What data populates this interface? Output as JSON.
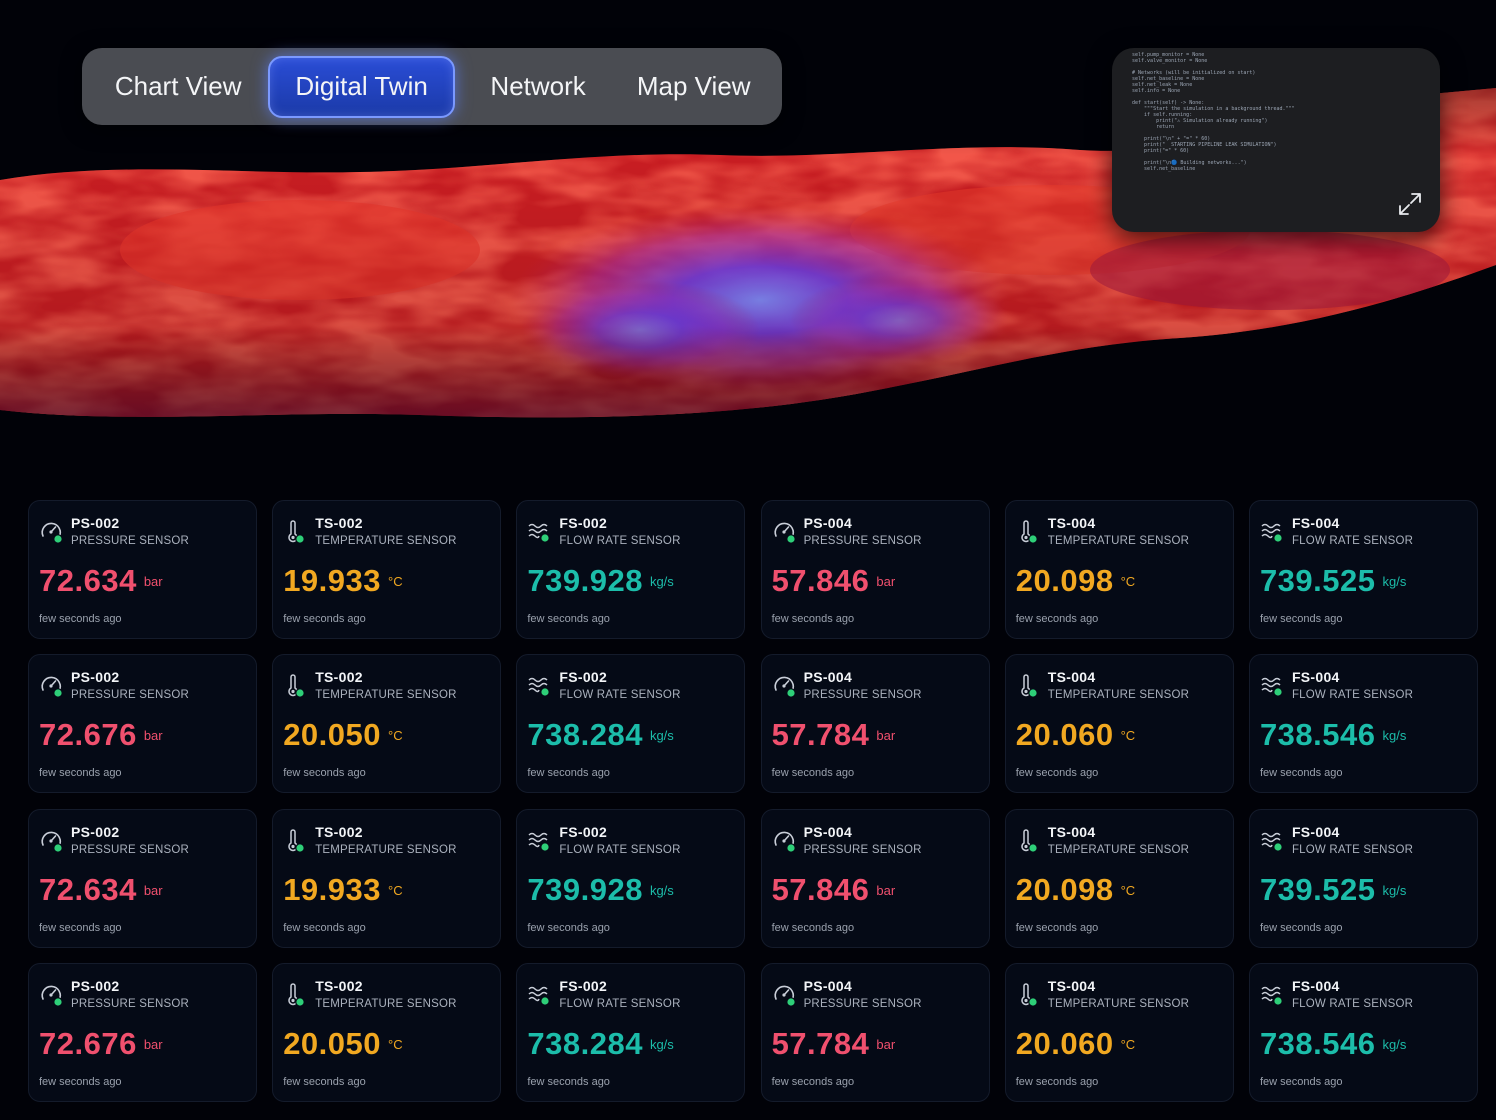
{
  "tabs": [
    {
      "label": "Chart View",
      "active": false
    },
    {
      "label": "Digital Twin",
      "active": true
    },
    {
      "label": "Network",
      "active": false
    },
    {
      "label": "Map View",
      "active": false
    }
  ],
  "code_panel": {
    "lines": [
      "self.pump_monitor = None",
      "self.valve_monitor = None",
      "",
      "# Networks (will be initialized on start)",
      "self.net_baseline = None",
      "self.net_leak = None",
      "self.info = None",
      "",
      "def start(self) -> None:",
      "    \"\"\"Start the simulation in a background thread.\"\"\"",
      "    if self.running:",
      "        print(\"⚠ Simulation already running\")",
      "        return",
      "",
      "    print(\"\\n\" + \"=\" * 60)",
      "    print(\"  STARTING PIPELINE LEAK SIMULATION\")",
      "    print(\"=\" * 60)",
      "",
      "    print(\"\\n🔵 Building networks...\")",
      "    self.net_baseline"
    ],
    "expand_icon": "expand-arrows-icon"
  },
  "colors": {
    "pressure": "#f0506e",
    "temperature": "#f1a821",
    "flow": "#1cbdaa",
    "status_dot": "#2ecf78",
    "active_tab": "#2a4dd6"
  },
  "sensor_rows": [
    [
      {
        "id": "PS-002",
        "type": "PRESSURE SENSOR",
        "kind": "pressure",
        "icon": "gauge-icon",
        "value": "72.634",
        "unit": "bar",
        "time": "few seconds ago"
      },
      {
        "id": "TS-002",
        "type": "TEMPERATURE SENSOR",
        "kind": "temperature",
        "icon": "thermometer-icon",
        "value": "19.933",
        "unit": "°C",
        "time": "few seconds ago"
      },
      {
        "id": "FS-002",
        "type": "FLOW RATE SENSOR",
        "kind": "flow",
        "icon": "waves-icon",
        "value": "739.928",
        "unit": "kg/s",
        "time": "few seconds ago"
      },
      {
        "id": "PS-004",
        "type": "PRESSURE SENSOR",
        "kind": "pressure",
        "icon": "gauge-icon",
        "value": "57.846",
        "unit": "bar",
        "time": "few seconds ago"
      },
      {
        "id": "TS-004",
        "type": "TEMPERATURE SENSOR",
        "kind": "temperature",
        "icon": "thermometer-icon",
        "value": "20.098",
        "unit": "°C",
        "time": "few seconds ago"
      },
      {
        "id": "FS-004",
        "type": "FLOW RATE SENSOR",
        "kind": "flow",
        "icon": "waves-icon",
        "value": "739.525",
        "unit": "kg/s",
        "time": "few seconds ago"
      }
    ],
    [
      {
        "id": "PS-002",
        "type": "PRESSURE SENSOR",
        "kind": "pressure",
        "icon": "gauge-icon",
        "value": "72.676",
        "unit": "bar",
        "time": "few seconds ago"
      },
      {
        "id": "TS-002",
        "type": "TEMPERATURE SENSOR",
        "kind": "temperature",
        "icon": "thermometer-icon",
        "value": "20.050",
        "unit": "°C",
        "time": "few seconds ago"
      },
      {
        "id": "FS-002",
        "type": "FLOW RATE SENSOR",
        "kind": "flow",
        "icon": "waves-icon",
        "value": "738.284",
        "unit": "kg/s",
        "time": "few seconds ago"
      },
      {
        "id": "PS-004",
        "type": "PRESSURE SENSOR",
        "kind": "pressure",
        "icon": "gauge-icon",
        "value": "57.784",
        "unit": "bar",
        "time": "few seconds ago"
      },
      {
        "id": "TS-004",
        "type": "TEMPERATURE SENSOR",
        "kind": "temperature",
        "icon": "thermometer-icon",
        "value": "20.060",
        "unit": "°C",
        "time": "few seconds ago"
      },
      {
        "id": "FS-004",
        "type": "FLOW RATE SENSOR",
        "kind": "flow",
        "icon": "waves-icon",
        "value": "738.546",
        "unit": "kg/s",
        "time": "few seconds ago"
      }
    ],
    [
      {
        "id": "PS-002",
        "type": "PRESSURE SENSOR",
        "kind": "pressure",
        "icon": "gauge-icon",
        "value": "72.634",
        "unit": "bar",
        "time": "few seconds ago"
      },
      {
        "id": "TS-002",
        "type": "TEMPERATURE SENSOR",
        "kind": "temperature",
        "icon": "thermometer-icon",
        "value": "19.933",
        "unit": "°C",
        "time": "few seconds ago"
      },
      {
        "id": "FS-002",
        "type": "FLOW RATE SENSOR",
        "kind": "flow",
        "icon": "waves-icon",
        "value": "739.928",
        "unit": "kg/s",
        "time": "few seconds ago"
      },
      {
        "id": "PS-004",
        "type": "PRESSURE SENSOR",
        "kind": "pressure",
        "icon": "gauge-icon",
        "value": "57.846",
        "unit": "bar",
        "time": "few seconds ago"
      },
      {
        "id": "TS-004",
        "type": "TEMPERATURE SENSOR",
        "kind": "temperature",
        "icon": "thermometer-icon",
        "value": "20.098",
        "unit": "°C",
        "time": "few seconds ago"
      },
      {
        "id": "FS-004",
        "type": "FLOW RATE SENSOR",
        "kind": "flow",
        "icon": "waves-icon",
        "value": "739.525",
        "unit": "kg/s",
        "time": "few seconds ago"
      }
    ],
    [
      {
        "id": "PS-002",
        "type": "PRESSURE SENSOR",
        "kind": "pressure",
        "icon": "gauge-icon",
        "value": "72.676",
        "unit": "bar",
        "time": "few seconds ago"
      },
      {
        "id": "TS-002",
        "type": "TEMPERATURE SENSOR",
        "kind": "temperature",
        "icon": "thermometer-icon",
        "value": "20.050",
        "unit": "°C",
        "time": "few seconds ago"
      },
      {
        "id": "FS-002",
        "type": "FLOW RATE SENSOR",
        "kind": "flow",
        "icon": "waves-icon",
        "value": "738.284",
        "unit": "kg/s",
        "time": "few seconds ago"
      },
      {
        "id": "PS-004",
        "type": "PRESSURE SENSOR",
        "kind": "pressure",
        "icon": "gauge-icon",
        "value": "57.784",
        "unit": "bar",
        "time": "few seconds ago"
      },
      {
        "id": "TS-004",
        "type": "TEMPERATURE SENSOR",
        "kind": "temperature",
        "icon": "thermometer-icon",
        "value": "20.060",
        "unit": "°C",
        "time": "few seconds ago"
      },
      {
        "id": "FS-004",
        "type": "FLOW RATE SENSOR",
        "kind": "flow",
        "icon": "waves-icon",
        "value": "738.546",
        "unit": "kg/s",
        "time": "few seconds ago"
      }
    ]
  ]
}
